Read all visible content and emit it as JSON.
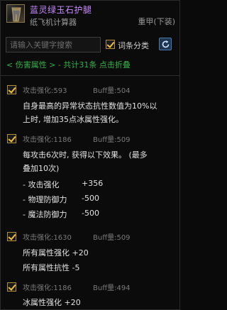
{
  "item": {
    "name": "蓝灵绿玉石护腿",
    "subtitle": "纸飞机计算器",
    "type": "重甲(下装)",
    "icon": "leg-armor-icon"
  },
  "search": {
    "placeholder": "请输入关键字搜索"
  },
  "filter": {
    "label": "词条分类",
    "checked": true
  },
  "refresh_icon": "refresh-icon",
  "summary": "< 伤害属性 > - 共计31条 点击折叠",
  "colors": {
    "item_name": "#c98bff",
    "summary": "#35b34a",
    "check": "#f0c040"
  },
  "entries": [
    {
      "stat": "攻击强化:593",
      "buff": "Buff量:504",
      "lines": [
        "自身最高的异常状态抗性数值为10%以",
        "上时, 增加35点冰属性强化。"
      ]
    },
    {
      "stat": "攻击强化:1186",
      "buff": "Buff量:509",
      "lines": [
        "每攻击6次时, 获得以下效果。 (最多",
        "叠加10次)"
      ],
      "effects": [
        {
          "name": "- 攻击强化",
          "value": "+356"
        },
        {
          "name": "- 物理防御力",
          "value": "-500"
        },
        {
          "name": "- 魔法防御力",
          "value": "-500"
        }
      ]
    },
    {
      "stat": "攻击强化:1630",
      "buff": "Buff量:509",
      "lines": [
        "所有属性强化 +20",
        "所有属性抗性 -5"
      ]
    },
    {
      "stat": "攻击强化:1186",
      "buff": "Buff量:494",
      "lines": [
        "冰属性强化 +20"
      ]
    }
  ]
}
